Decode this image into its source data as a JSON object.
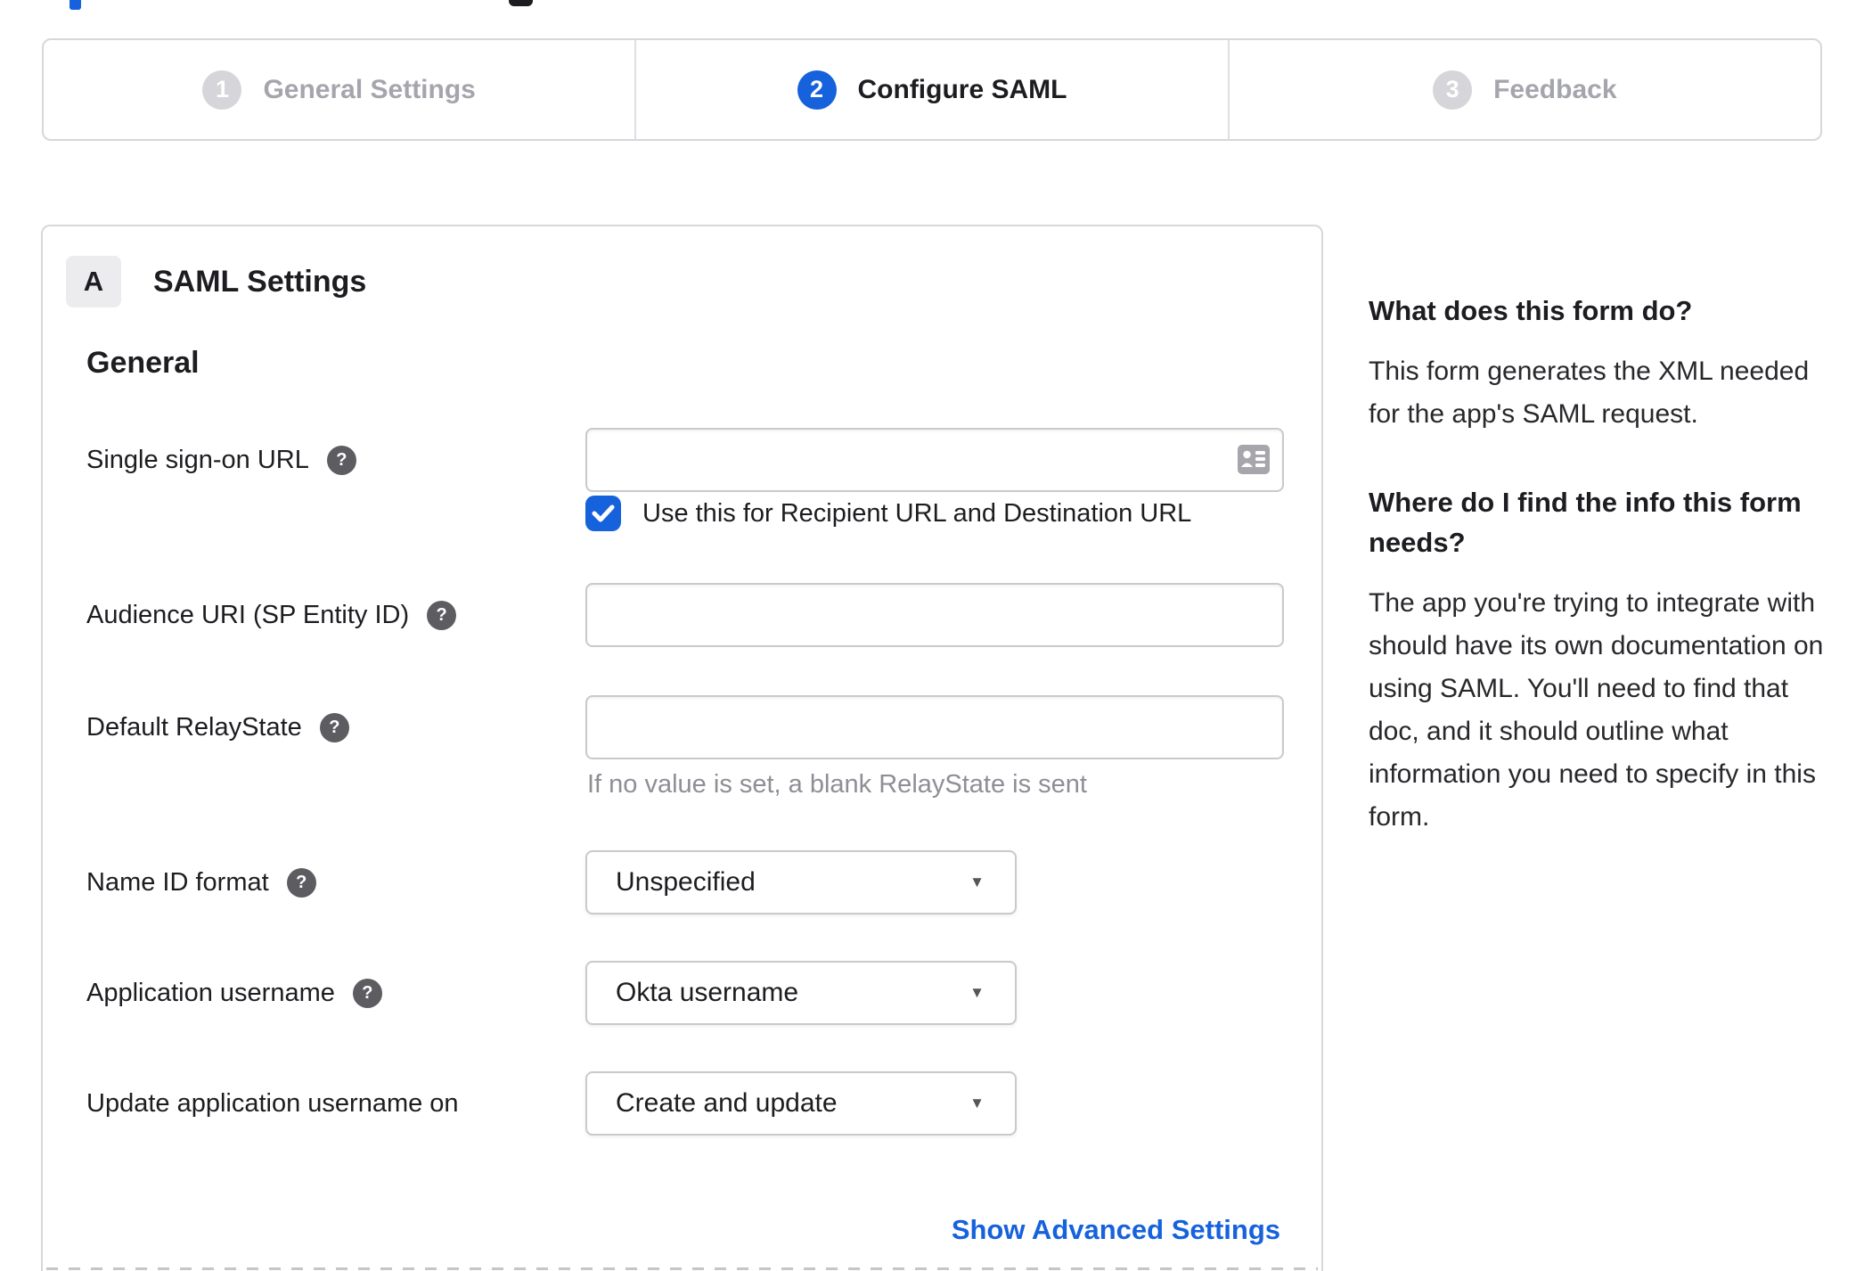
{
  "stepper": {
    "steps": [
      {
        "number": "1",
        "label": "General Settings",
        "state": "inactive"
      },
      {
        "number": "2",
        "label": "Configure SAML",
        "state": "active"
      },
      {
        "number": "3",
        "label": "Feedback",
        "state": "inactive"
      }
    ]
  },
  "panel": {
    "badge_letter": "A",
    "title": "SAML Settings",
    "section_heading": "General",
    "fields": {
      "sso": {
        "label": "Single sign-on URL",
        "value": "",
        "checkbox_label": "Use this for Recipient URL and Destination URL",
        "checkbox_checked": true
      },
      "audience": {
        "label": "Audience URI (SP Entity ID)",
        "value": ""
      },
      "relay": {
        "label": "Default RelayState",
        "value": "",
        "hint": "If no value is set, a blank RelayState is sent"
      },
      "nameid": {
        "label": "Name ID format",
        "value": "Unspecified"
      },
      "appuser": {
        "label": "Application username",
        "value": "Okta username"
      },
      "updateon": {
        "label": "Update application username on",
        "value": "Create and update"
      }
    },
    "advanced_link": "Show Advanced Settings"
  },
  "sidebar": {
    "question1": "What does this form do?",
    "answer1": "This form generates the XML needed for the app's SAML request.",
    "question2": "Where do I find the info this form needs?",
    "answer2": "The app you're trying to integrate with should have its own documentation on using SAML. You'll need to find that doc, and it should outline what information you need to specify in this form."
  },
  "glyphs": {
    "help": "?",
    "caret": "▼"
  },
  "colors": {
    "accent_blue": "#1662dd",
    "text_dark": "#1d1d21",
    "muted_gray": "#8e8e96",
    "inactive_gray": "#a5a5ad",
    "panel_border": "#d7d7dc"
  }
}
